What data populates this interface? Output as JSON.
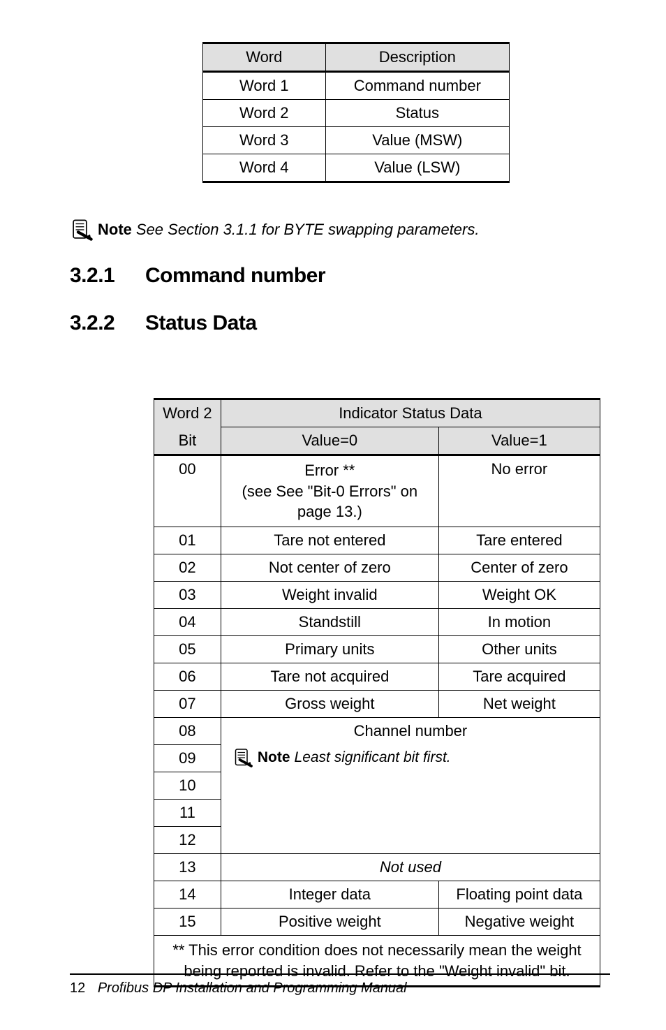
{
  "table1": {
    "headers": [
      "Word",
      "Description"
    ],
    "rows": [
      [
        "Word 1",
        "Command number"
      ],
      [
        "Word 2",
        "Status"
      ],
      [
        "Word 3",
        "Value (MSW)"
      ],
      [
        "Word 4",
        "Value (LSW)"
      ]
    ]
  },
  "note1": {
    "label": "Note",
    "text": "See Section 3.1.1 for BYTE swapping parameters."
  },
  "heading1": {
    "num": "3.2.1",
    "title": "Command number"
  },
  "heading2": {
    "num": "3.2.2",
    "title": "Status Data"
  },
  "table2": {
    "corner_top": "Word 2",
    "corner_bottom": "Bit",
    "super_header": "Indicator Status Data",
    "sub_headers": [
      "Value=0",
      "Value=1"
    ],
    "rows_simple": [
      {
        "bit": "00",
        "v0_lines": [
          "Error **",
          "(see See \"Bit-0 Errors\" on",
          "page 13.)"
        ],
        "v1": "No error"
      },
      {
        "bit": "01",
        "v0": "Tare not entered",
        "v1": "Tare entered"
      },
      {
        "bit": "02",
        "v0": "Not center of zero",
        "v1": "Center of zero"
      },
      {
        "bit": "03",
        "v0": "Weight invalid",
        "v1": "Weight OK"
      },
      {
        "bit": "04",
        "v0": "Standstill",
        "v1": "In motion"
      },
      {
        "bit": "05",
        "v0": "Primary units",
        "v1": "Other units"
      },
      {
        "bit": "06",
        "v0": "Tare not acquired",
        "v1": "Tare acquired"
      },
      {
        "bit": "07",
        "v0": "Gross weight",
        "v1": "Net weight"
      }
    ],
    "channel_block": {
      "bits": [
        "08",
        "09",
        "10",
        "11",
        "12"
      ],
      "line1": "Channel number",
      "note_label": "Note",
      "note_text": "Least significant bit first."
    },
    "row_notused": {
      "bit": "13",
      "text": "Not used"
    },
    "row_14": {
      "bit": "14",
      "v0": "Integer data",
      "v1": "Floating point data"
    },
    "row_15": {
      "bit": "15",
      "v0": "Positive weight",
      "v1": "Negative weight"
    },
    "footnote_lines": [
      "** This error condition does not necessarily mean the weight",
      "being reported is invalid. Refer to the \"Weight invalid\" bit."
    ]
  },
  "footer": {
    "page": "12",
    "title": "Profibus DP Installation and Programming Manual"
  }
}
